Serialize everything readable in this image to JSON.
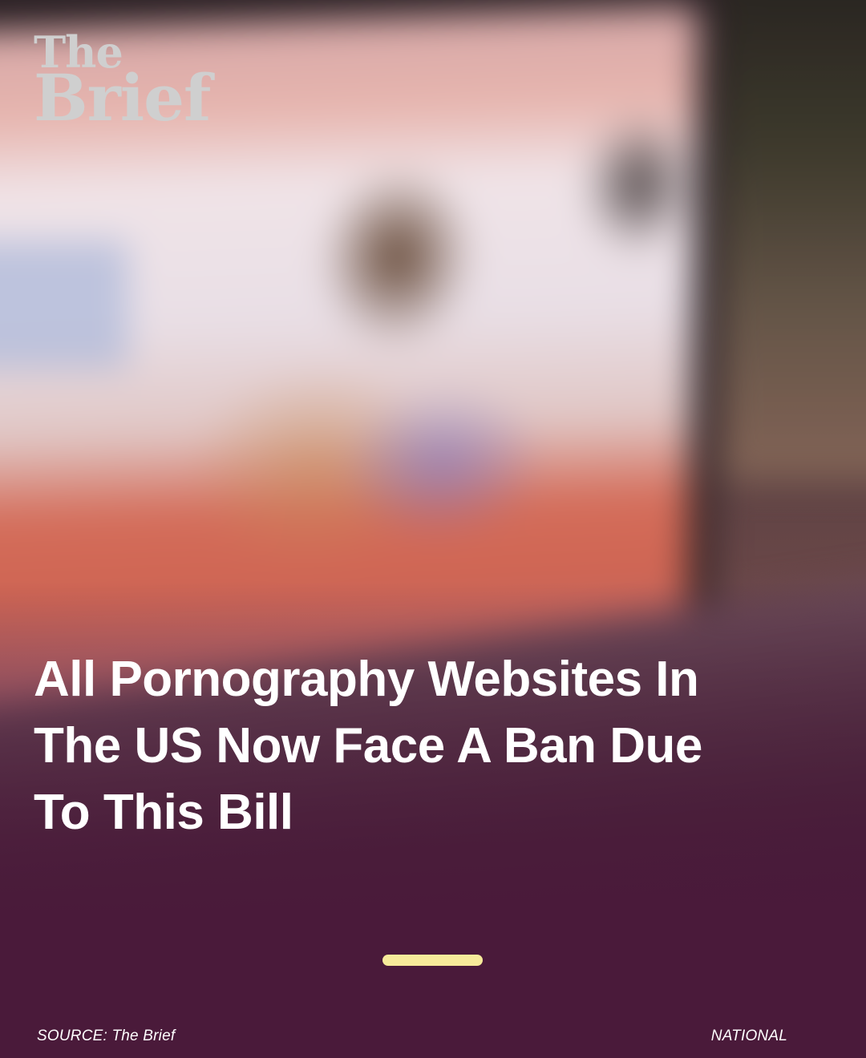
{
  "brand": {
    "logo_line1": "The",
    "logo_line2": "Brief"
  },
  "headline": {
    "text": "All Pornography Websites In The US Now Face A Ban Due To This Bill"
  },
  "footer": {
    "source": "SOURCE: The Brief",
    "category": "NATIONAL"
  },
  "image": {
    "icon": "blurred-laptop-photo"
  },
  "colors": {
    "background": "#4a1a3a",
    "accent": "#f7ea9a",
    "text": "#ffffff",
    "logo": "#cfcfcf"
  }
}
